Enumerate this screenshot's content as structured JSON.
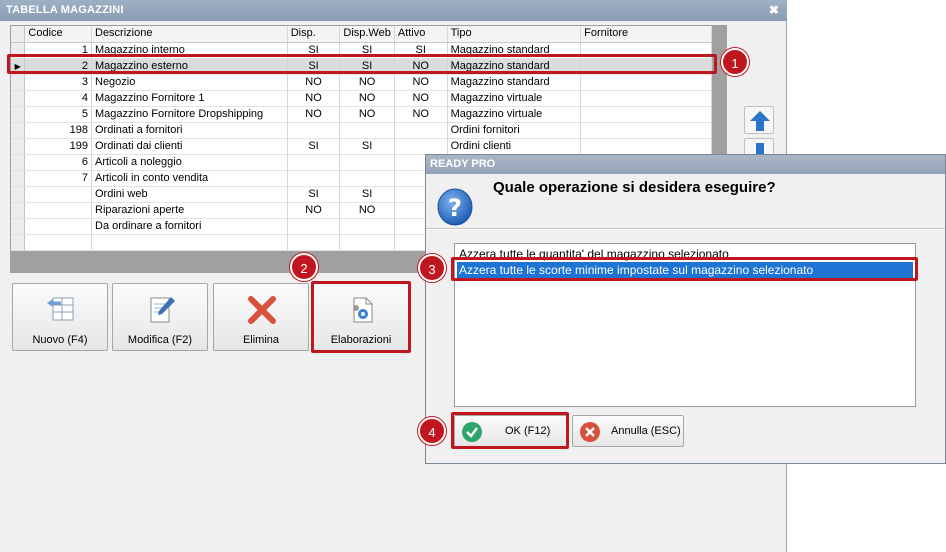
{
  "window": {
    "title": "TABELLA MAGAZZINI",
    "close_glyph": "✖"
  },
  "table": {
    "columns": [
      "Codice",
      "Descrizione",
      "Disp.",
      "Disp.Web",
      "Attivo",
      "Tipo",
      "Fornitore"
    ],
    "selected_row": 1,
    "rows": [
      {
        "codice": "1",
        "descrizione": "Magazzino interno",
        "disp": "SI",
        "disp_web": "SI",
        "attivo": "SI",
        "tipo": "Magazzino standard",
        "fornitore": ""
      },
      {
        "codice": "2",
        "descrizione": "Magazzino esterno",
        "disp": "SI",
        "disp_web": "SI",
        "attivo": "NO",
        "tipo": "Magazzino standard",
        "fornitore": ""
      },
      {
        "codice": "3",
        "descrizione": "Negozio",
        "disp": "NO",
        "disp_web": "NO",
        "attivo": "NO",
        "tipo": "Magazzino standard",
        "fornitore": ""
      },
      {
        "codice": "4",
        "descrizione": "Magazzino Fornitore 1",
        "disp": "NO",
        "disp_web": "NO",
        "attivo": "NO",
        "tipo": "Magazzino virtuale",
        "fornitore": ""
      },
      {
        "codice": "5",
        "descrizione": "Magazzino Fornitore Dropshipping",
        "disp": "NO",
        "disp_web": "NO",
        "attivo": "NO",
        "tipo": "Magazzino virtuale",
        "fornitore": ""
      },
      {
        "codice": "198",
        "descrizione": "Ordinati a fornitori",
        "disp": "",
        "disp_web": "",
        "attivo": "",
        "tipo": "Ordini fornitori",
        "fornitore": ""
      },
      {
        "codice": "199",
        "descrizione": "Ordinati dai clienti",
        "disp": "SI",
        "disp_web": "SI",
        "attivo": "",
        "tipo": "Ordini clienti",
        "fornitore": ""
      },
      {
        "codice": "6",
        "descrizione": "Articoli a noleggio",
        "disp": "",
        "disp_web": "",
        "attivo": "",
        "tipo": "",
        "fornitore": ""
      },
      {
        "codice": "7",
        "descrizione": "Articoli in conto vendita",
        "disp": "",
        "disp_web": "",
        "attivo": "",
        "tipo": "",
        "fornitore": ""
      },
      {
        "codice": "",
        "descrizione": "Ordini web",
        "disp": "SI",
        "disp_web": "SI",
        "attivo": "",
        "tipo": "",
        "fornitore": ""
      },
      {
        "codice": "",
        "descrizione": "Riparazioni aperte",
        "disp": "NO",
        "disp_web": "NO",
        "attivo": "",
        "tipo": "",
        "fornitore": ""
      },
      {
        "codice": "",
        "descrizione": "Da ordinare a fornitori",
        "disp": "",
        "disp_web": "",
        "attivo": "",
        "tipo": "",
        "fornitore": ""
      },
      {
        "codice": "",
        "descrizione": "",
        "disp": "",
        "disp_web": "",
        "attivo": "",
        "tipo": "",
        "fornitore": ""
      }
    ]
  },
  "toolbar": {
    "nuovo": "Nuovo (F4)",
    "modifica": "Modifica (F2)",
    "elimina": "Elimina",
    "elaborazioni": "Elaborazioni"
  },
  "side_buttons": {
    "up_icon": "arrow-up-icon",
    "down_icon": "arrow-down-icon"
  },
  "dialog": {
    "title": "READY PRO",
    "question": "Quale operazione si desidera eseguire?",
    "options": [
      "Azzera tutte le quantita' del magazzino selezionato",
      "Azzera tutte le scorte minime impostate sul magazzino selezionato"
    ],
    "selected_option": 1,
    "ok_label": "OK (F12)",
    "cancel_label": "Annulla (ESC)"
  },
  "annotations": [
    "1",
    "2",
    "3",
    "4"
  ],
  "colors": {
    "highlight": "#c0161f",
    "selection": "#1e74d2",
    "ok_green": "#2fa56a",
    "cancel_red": "#d9503f",
    "arrow_blue": "#2b73c7"
  }
}
